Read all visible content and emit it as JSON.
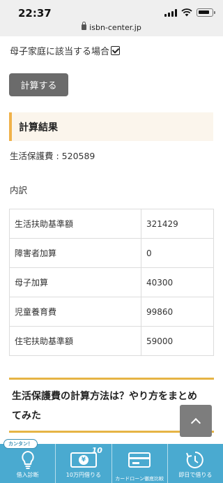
{
  "status_bar": {
    "time": "22:37"
  },
  "browser": {
    "url": "isbn-center.jp"
  },
  "form": {
    "single_parent_label": "母子家庭に該当する場合",
    "single_parent_checked": true,
    "calculate_button": "計算する"
  },
  "result": {
    "heading": "計算結果",
    "total_line": "生活保護費 : 520589",
    "breakdown_label": "内訳",
    "table": [
      {
        "label": "生活扶助基準額",
        "value": "321429"
      },
      {
        "label": "障害者加算",
        "value": "0"
      },
      {
        "label": "母子加算",
        "value": "40300"
      },
      {
        "label": "児童養育費",
        "value": "99860"
      },
      {
        "label": "住宅扶助基準額",
        "value": "59000"
      }
    ]
  },
  "section": {
    "title": "生活保護費の計算方法は？やり方をまとめてみた"
  },
  "bottom_nav": {
    "items": [
      {
        "label": "借入診断",
        "badge": "カンタン！",
        "icon": "lightbulb-icon"
      },
      {
        "label": "10万円借りる",
        "icon": "yen-card-icon",
        "icon_text": "10"
      },
      {
        "label": "カードローン徹底比較",
        "icon": "credit-card-icon"
      },
      {
        "label": "即日で借りる",
        "icon": "clock-icon"
      }
    ]
  },
  "colors": {
    "accent_gold": "#e6b445",
    "heading_bg": "#fbf5ec",
    "button_gray": "#6b6b6b",
    "nav_blue": "#4aaad0"
  }
}
